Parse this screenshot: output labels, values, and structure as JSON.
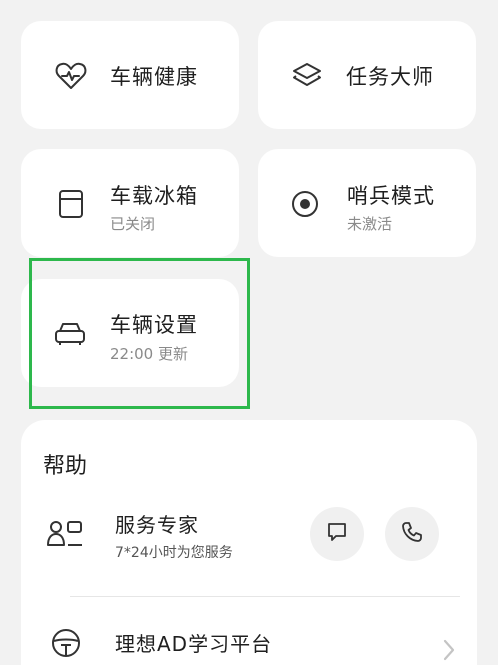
{
  "tiles": {
    "vehicle_health": {
      "title": "车辆健康"
    },
    "task_master": {
      "title": "任务大师"
    },
    "fridge": {
      "title": "车载冰箱",
      "status": "已关闭"
    },
    "sentry": {
      "title": "哨兵模式",
      "status": "未激活"
    },
    "vehicle_settings": {
      "title": "车辆设置",
      "status": "22:00 更新"
    }
  },
  "help": {
    "heading": "帮助",
    "service_expert": {
      "title": "服务专家",
      "subtitle": "7*24小时为您服务"
    },
    "ad_learning": {
      "title": "理想AD学习平台"
    }
  },
  "colors": {
    "highlight": "#2db84c",
    "card_bg": "#ffffff",
    "page_bg": "#f2f2f2"
  }
}
